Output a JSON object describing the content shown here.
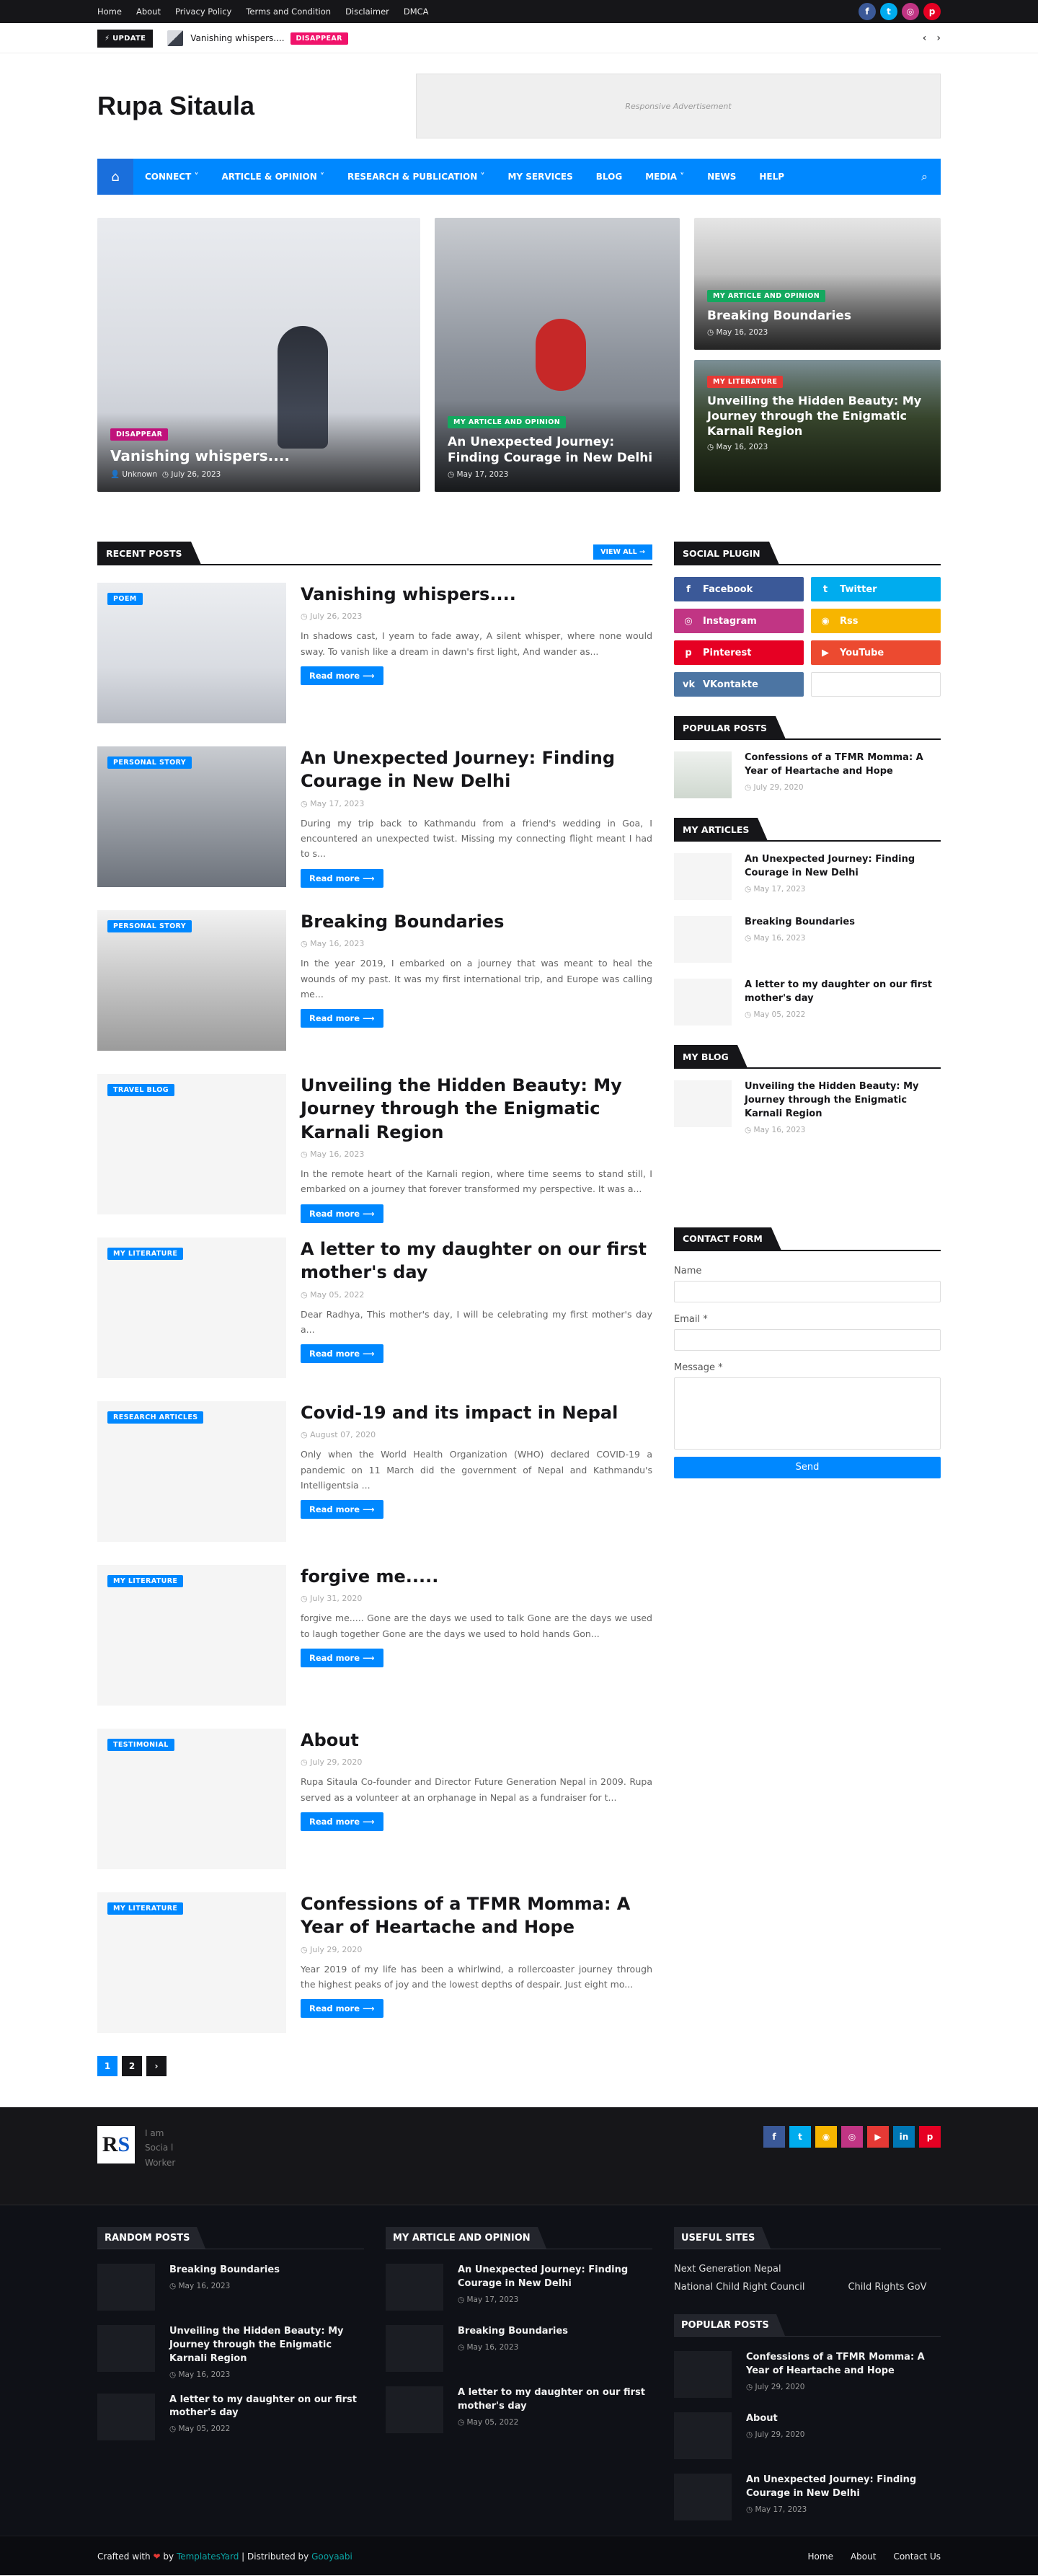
{
  "topbar": {
    "links": [
      "Home",
      "About",
      "Privacy Policy",
      "Terms and Condition",
      "Disclaimer",
      "DMCA"
    ],
    "social": [
      {
        "icon": "facebook-icon",
        "glyph": "f",
        "color": "#3b5998"
      },
      {
        "icon": "twitter-icon",
        "glyph": "t",
        "color": "#00acee"
      },
      {
        "icon": "instagram-icon",
        "glyph": "◎",
        "color": "#c13584"
      },
      {
        "icon": "pinterest-icon",
        "glyph": "p",
        "color": "#e60023"
      }
    ]
  },
  "ticker": {
    "label": "⚡ UPDATE",
    "title": "Vanishing whispers....",
    "tag": "DISAPPEAR",
    "tag_color": "#f0136b"
  },
  "header": {
    "site_title": "Rupa Sitaula",
    "ad_text": "Responsive Advertisement"
  },
  "nav": {
    "items": [
      "CONNECT ˅",
      "ARTICLE & OPINION ˅",
      "RESEARCH & PUBLICATION ˅",
      "MY SERVICES",
      "BLOG",
      "MEDIA ˅",
      "NEWS",
      "HELP"
    ]
  },
  "featured": [
    {
      "tag": "DISAPPEAR",
      "tag_color": "#c0127b",
      "title": "Vanishing whispers....",
      "author": "Unknown",
      "date": "July 26, 2023"
    },
    {
      "tag": "MY ARTICLE AND OPINION",
      "tag_color": "#14a85f",
      "title": "An Unexpected Journey: Finding Courage in New Delhi",
      "date": "May 17, 2023"
    },
    {
      "tag": "MY ARTICLE AND OPINION",
      "tag_color": "#14a85f",
      "title": "Breaking Boundaries",
      "date": "May 16, 2023"
    },
    {
      "tag": "MY LITERATURE",
      "tag_color": "#e53935",
      "title": "Unveiling the Hidden Beauty: My Journey through the Enigmatic Karnali Region",
      "date": "May 16, 2023"
    }
  ],
  "recent": {
    "heading": "RECENT POSTS",
    "view_all": "VIEW ALL →",
    "read_more": "Read more ⟶",
    "posts": [
      {
        "tag": "POEM",
        "title": "Vanishing whispers....",
        "date": "July 26, 2023",
        "snippet": "In shadows cast, I yearn to fade away, A silent whisper, where none would sway. To vanish like a dream in dawn's first light, And wander as..."
      },
      {
        "tag": "PERSONAL STORY",
        "title": "An Unexpected Journey: Finding Courage in New Delhi",
        "date": "May 17, 2023",
        "snippet": "During my trip back to Kathmandu from a friend's wedding in Goa, I encountered an unexpected twist. Missing my connecting flight meant I had to s..."
      },
      {
        "tag": "PERSONAL STORY",
        "title": "Breaking Boundaries",
        "date": "May 16, 2023",
        "snippet": "In the year 2019, I embarked on a journey that was meant to heal the wounds of my past. It was my first international trip, and Europe was calling me..."
      },
      {
        "tag": "TRAVEL BLOG",
        "title": "Unveiling the Hidden Beauty: My Journey through the Enigmatic Karnali Region",
        "date": "May 16, 2023",
        "snippet": "In the remote heart of the Karnali region, where time seems to stand still, I embarked on a journey that forever transformed my perspective. It was a..."
      },
      {
        "tag": "MY LITERATURE",
        "title": "A letter to my daughter on our first mother's day",
        "date": "May 05, 2022",
        "snippet": "Dear Radhya, This mother's day, I will be celebrating my first mother's day a..."
      },
      {
        "tag": "RESEARCH ARTICLES",
        "title": "Covid-19 and its impact in Nepal",
        "date": "August 07, 2020",
        "snippet": "Only when the World Health Organization (WHO) declared COVID-19 a pandemic on 11 March did the government of Nepal and Kathmandu's Intelligentsia ..."
      },
      {
        "tag": "MY LITERATURE",
        "title": "forgive me.....",
        "date": "July 31, 2020",
        "snippet": "forgive me..... Gone are the days we used to talk Gone are the days we used to laugh together Gone are the days we used to hold hands Gon..."
      },
      {
        "tag": "TESTIMONIAL",
        "title": "About",
        "date": "July 29, 2020",
        "snippet": "Rupa Sitaula  Co-founder and Director Future Generation Nepal in 2009. Rupa served as a volunteer at an orphanage in Nepal as a fundraiser for t..."
      },
      {
        "tag": "MY LITERATURE",
        "title": "Confessions of a TFMR Momma: A Year of Heartache and Hope",
        "date": "July 29, 2020",
        "snippet": "Year 2019 of my life has been a whirlwind, a rollercoaster journey through the highest peaks of joy and the lowest depths of despair. Just eight mo..."
      }
    ],
    "pages": [
      "1",
      "2",
      "›"
    ]
  },
  "sidebar": {
    "social_heading": "SOCIAL PLUGIN",
    "social_buttons": [
      {
        "label": "Facebook",
        "glyph": "f",
        "color": "#3b5998"
      },
      {
        "label": "Twitter",
        "glyph": "t",
        "color": "#00acee"
      },
      {
        "label": "Instagram",
        "glyph": "◎",
        "color": "#c13584"
      },
      {
        "label": "Rss",
        "glyph": "◉",
        "color": "#f7b500"
      },
      {
        "label": "Pinterest",
        "glyph": "p",
        "color": "#e60023"
      },
      {
        "label": "YouTube",
        "glyph": "▶",
        "color": "#ec4a30"
      },
      {
        "label": "VKontakte",
        "glyph": "vk",
        "color": "#4c75a3"
      },
      {
        "label": "",
        "glyph": "",
        "color": "#ffffff"
      }
    ],
    "popular_heading": "POPULAR POSTS",
    "popular": [
      {
        "title": "Confessions of a TFMR Momma: A Year of Heartache and Hope",
        "date": "July 29, 2020"
      }
    ],
    "articles_heading": "MY ARTICLES",
    "articles": [
      {
        "title": "An Unexpected Journey: Finding Courage in New Delhi",
        "date": "May 17, 2023"
      },
      {
        "title": "Breaking Boundaries",
        "date": "May 16, 2023"
      },
      {
        "title": "A letter to my daughter on our first mother's day",
        "date": "May 05, 2022"
      }
    ],
    "blog_heading": "MY BLOG",
    "blog": [
      {
        "title": "Unveiling the Hidden Beauty: My Journey through the Enigmatic Karnali Region",
        "date": "May 16, 2023"
      }
    ],
    "contact_heading": "CONTACT FORM",
    "contact": {
      "name_label": "Name",
      "email_label": "Email *",
      "message_label": "Message *",
      "send_label": "Send"
    }
  },
  "footer": {
    "about_text": "I am Socia l Worker",
    "social": [
      {
        "icon": "facebook-icon",
        "glyph": "f",
        "color": "#3b5998"
      },
      {
        "icon": "twitter-icon",
        "glyph": "t",
        "color": "#00acee"
      },
      {
        "icon": "rss-icon",
        "glyph": "◉",
        "color": "#f7b500"
      },
      {
        "icon": "instagram-icon",
        "glyph": "◎",
        "color": "#c13584"
      },
      {
        "icon": "youtube-icon",
        "glyph": "▶",
        "color": "#e53935"
      },
      {
        "icon": "linkedin-icon",
        "glyph": "in",
        "color": "#0077b5"
      },
      {
        "icon": "pinterest-icon",
        "glyph": "p",
        "color": "#e60023"
      }
    ],
    "random_heading": "RANDOM POSTS",
    "random": [
      {
        "title": "Breaking Boundaries",
        "date": "May 16, 2023"
      },
      {
        "title": "Unveiling the Hidden Beauty: My Journey through the Enigmatic Karnali Region",
        "date": "May 16, 2023"
      },
      {
        "title": "A letter to my daughter on our first mother's day",
        "date": "May 05, 2022"
      }
    ],
    "opinion_heading": "MY ARTICLE AND OPINION",
    "opinion": [
      {
        "title": "An Unexpected Journey: Finding Courage in New Delhi",
        "date": "May 17, 2023"
      },
      {
        "title": "Breaking Boundaries",
        "date": "May 16, 2023"
      },
      {
        "title": "A letter to my daughter on our first mother's day",
        "date": "May 05, 2022"
      }
    ],
    "useful_heading": "USEFUL SITES",
    "useful": [
      "Next Generation Nepal",
      "National Child Right Council",
      "Child Rights GoV"
    ],
    "popular_heading": "POPULAR POSTS",
    "popular": [
      {
        "title": "Confessions of a TFMR Momma: A Year of Heartache and Hope",
        "date": "July 29, 2020"
      },
      {
        "title": "About",
        "date": "July 29, 2020"
      },
      {
        "title": "An Unexpected Journey: Finding Courage in New Delhi",
        "date": "May 17, 2023"
      }
    ],
    "credit_prefix": "Crafted with",
    "credit_by": "by",
    "credit_templates": "TemplatesYard",
    "credit_mid": "| Distributed by",
    "credit_gooyaabi": "Gooyaabi",
    "links": [
      "Home",
      "About",
      "Contact Us"
    ]
  }
}
